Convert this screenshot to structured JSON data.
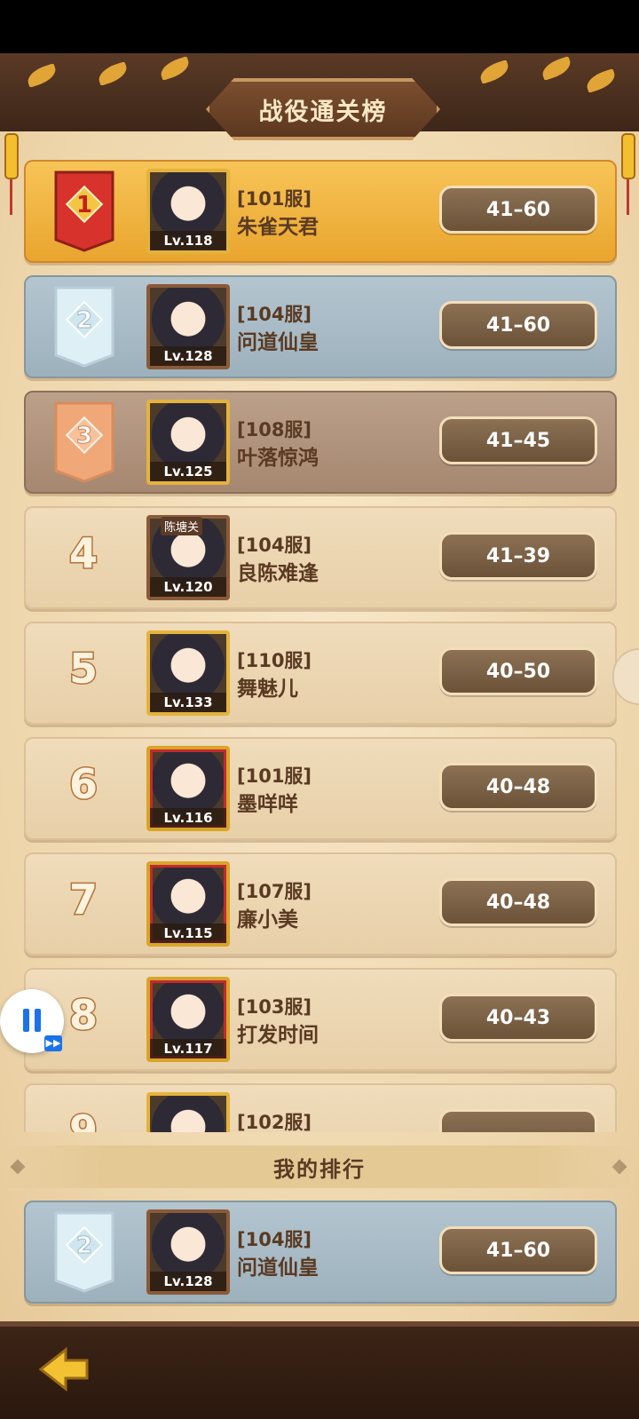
{
  "title": "战役通关榜",
  "my_rank_label": "我的排行",
  "colors": {
    "gold_row": "#f0b542",
    "silver_row": "#a8bbc6",
    "bronze_row": "#b09179",
    "plain_row": "#ecd6b1",
    "score_pill": "#7b6146"
  },
  "rankings": [
    {
      "rank": "1",
      "server": "[101服]",
      "name": "朱雀天君",
      "level": "Lv.118",
      "score": "41–60"
    },
    {
      "rank": "2",
      "server": "[104服]",
      "name": "问道仙皇",
      "level": "Lv.128",
      "score": "41–60"
    },
    {
      "rank": "3",
      "server": "[108服]",
      "name": "叶落惊鸿",
      "level": "Lv.125",
      "score": "41–45"
    },
    {
      "rank": "4",
      "server": "[104服]",
      "name": "良陈难逢",
      "level": "Lv.120",
      "score": "41–39",
      "tag": "陈塘关"
    },
    {
      "rank": "5",
      "server": "[110服]",
      "name": "舞魅儿",
      "level": "Lv.133",
      "score": "40–50"
    },
    {
      "rank": "6",
      "server": "[101服]",
      "name": "墨咩咩",
      "level": "Lv.116",
      "score": "40–48"
    },
    {
      "rank": "7",
      "server": "[107服]",
      "name": "廉小美",
      "level": "Lv.115",
      "score": "40–48"
    },
    {
      "rank": "8",
      "server": "[103服]",
      "name": "打发时间",
      "level": "Lv.117",
      "score": "40–43"
    },
    {
      "rank": "9",
      "server": "[102服]",
      "name": "",
      "level": "",
      "score": ""
    }
  ],
  "my_ranking": {
    "rank": "2",
    "server": "[104服]",
    "name": "问道仙皇",
    "level": "Lv.128",
    "score": "41–60"
  },
  "icons": {
    "back": "back-arrow-icon",
    "pause": "pause-icon",
    "fast_forward": "fast-forward-icon"
  }
}
